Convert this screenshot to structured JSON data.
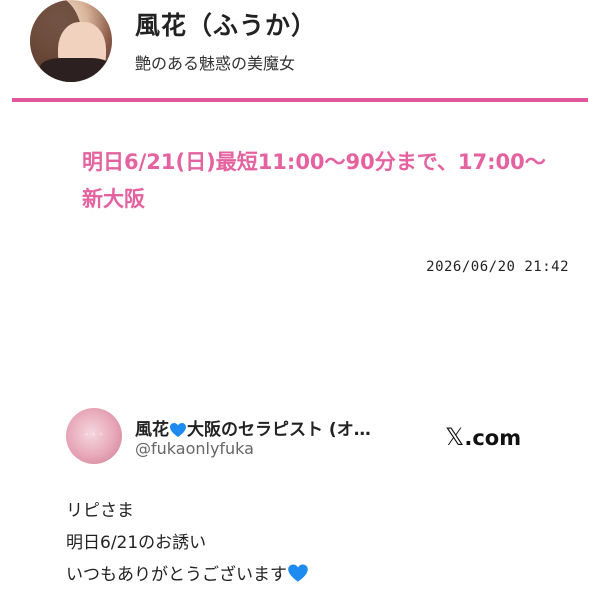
{
  "profile": {
    "name": "風花（ふうか）",
    "tagline": "艶のある魅惑の美魔女"
  },
  "post": {
    "headline": "明日6/21(日)最短11:00〜90分まで、17:00〜新大阪",
    "timestamp": "2026/06/20 21:42"
  },
  "embed": {
    "author_name_before": "風花",
    "author_name_after": "大阪のセラピスト (オ…",
    "heart_icon": "blue-heart-icon",
    "handle": "@fukaonlyfuka",
    "source_glyph": "𝕏",
    "source_suffix": ".com",
    "text_lines": [
      "リピさま",
      "明日6/21のお誘い",
      "いつもありがとうございます"
    ],
    "accent_color": "#1d8bf0"
  },
  "colors": {
    "brand_pink": "#e4629f",
    "divider_pink": "#e0579c"
  }
}
